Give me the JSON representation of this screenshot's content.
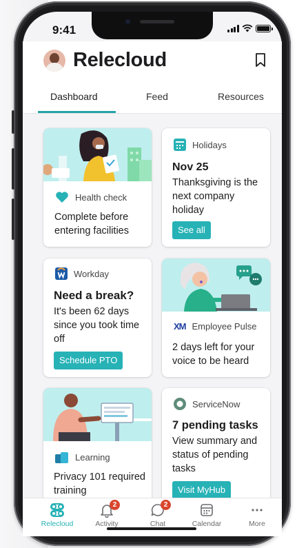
{
  "status_bar": {
    "time": "9:41"
  },
  "header": {
    "app_title": "Relecloud",
    "tabs": [
      {
        "label": "Dashboard",
        "active": true
      },
      {
        "label": "Feed",
        "active": false
      },
      {
        "label": "Resources",
        "active": false
      }
    ]
  },
  "cards": {
    "health": {
      "source": "Health check",
      "text": "Complete before entering facilities"
    },
    "holidays": {
      "source": "Holidays",
      "heading": "Nov 25",
      "text": "Thanksgiving is the next company holiday",
      "button": "See all"
    },
    "workday": {
      "source": "Workday",
      "heading": "Need a break?",
      "text": "It's been 62 days since you took time off",
      "button": "Schedule PTO"
    },
    "pulse": {
      "source": "Employee Pulse",
      "text": "2 days left for your voice to be heard"
    },
    "learning": {
      "source": "Learning",
      "text": "Privacy 101 required training"
    },
    "servicenow": {
      "source": "ServiceNow",
      "heading": "7 pending tasks",
      "text": "View summary and status of pending tasks",
      "button": "Visit MyHub"
    }
  },
  "bottom_nav": [
    {
      "label": "Relecloud",
      "active": true,
      "badge": ""
    },
    {
      "label": "Activity",
      "active": false,
      "badge": "2"
    },
    {
      "label": "Chat",
      "active": false,
      "badge": "2"
    },
    {
      "label": "Calendar",
      "active": false,
      "badge": ""
    },
    {
      "label": "More",
      "active": false,
      "badge": ""
    }
  ],
  "colors": {
    "accent": "#27b2b6",
    "badge": "#d9462d",
    "illustration_bg": "#bfeeee"
  }
}
